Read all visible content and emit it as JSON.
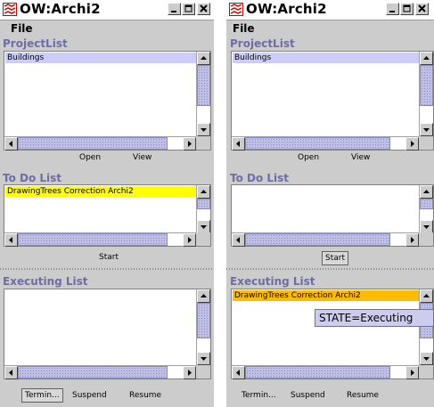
{
  "colors": {
    "selected_blue": "#ccccff",
    "selected_yellow": "#ffff00",
    "selected_orange": "#ffbb00",
    "section_title": "#6d6da6",
    "tooltip_bg": "#ccccee"
  },
  "windows": [
    {
      "title": "OW:Archi2",
      "menu": {
        "file": "File"
      },
      "project_list": {
        "title": "ProjectList",
        "items": [
          "Buildings"
        ]
      },
      "project_buttons": {
        "open": "Open",
        "view": "View"
      },
      "todo_list": {
        "title": "To Do List",
        "items": [
          "DrawingTrees Correction Archi2"
        ]
      },
      "start_label": "Start",
      "executing_list": {
        "title": "Executing List",
        "items": []
      },
      "bottom_buttons": {
        "terminate": "Termin...",
        "suspend": "Suspend",
        "resume": "Resume"
      }
    },
    {
      "title": "OW:Archi2",
      "menu": {
        "file": "File"
      },
      "project_list": {
        "title": "ProjectList",
        "items": [
          "Buildings"
        ]
      },
      "project_buttons": {
        "open": "Open",
        "view": "View"
      },
      "todo_list": {
        "title": "To Do List",
        "items": []
      },
      "start_label": "Start",
      "executing_list": {
        "title": "Executing List",
        "items": [
          "DrawingTrees Correction Archi2"
        ]
      },
      "bottom_buttons": {
        "terminate": "Termin...",
        "suspend": "Suspend",
        "resume": "Resume"
      }
    }
  ],
  "tooltip": "STATE=Executing"
}
